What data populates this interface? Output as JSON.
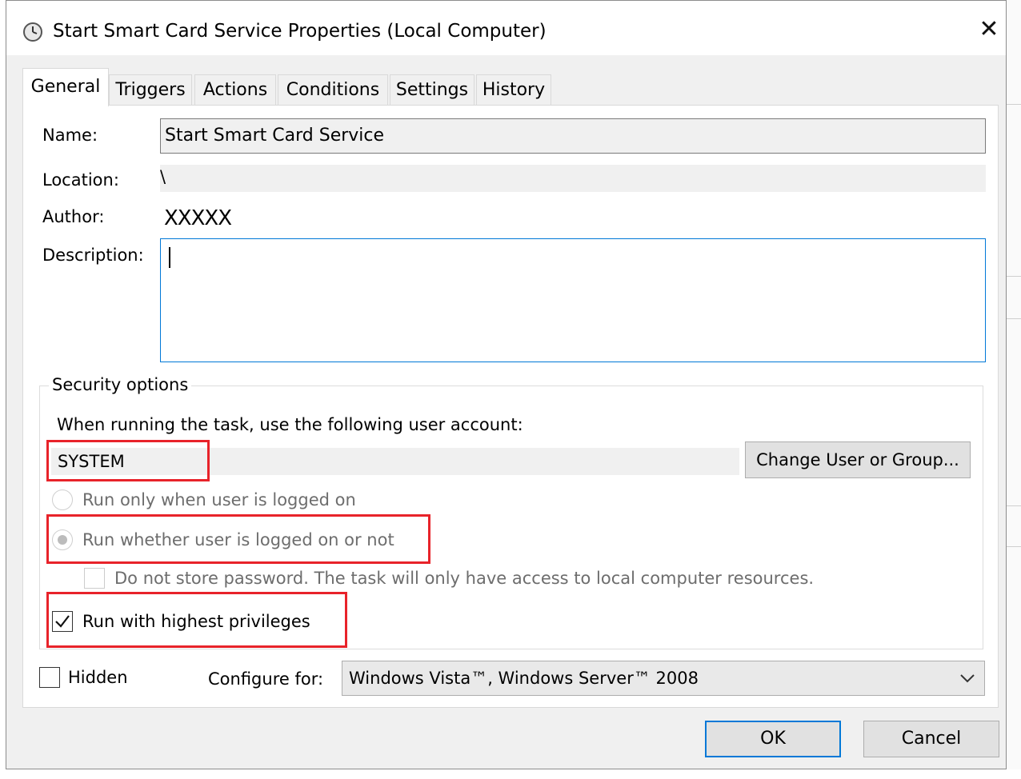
{
  "window": {
    "title": "Start Smart Card Service Properties (Local Computer)",
    "close_glyph": "✕",
    "icon": "clock-icon"
  },
  "tabs": [
    {
      "label": "General",
      "active": true
    },
    {
      "label": "Triggers"
    },
    {
      "label": "Actions"
    },
    {
      "label": "Conditions"
    },
    {
      "label": "Settings"
    },
    {
      "label": "History"
    }
  ],
  "general": {
    "name_label": "Name:",
    "name_value": "Start Smart Card Service",
    "location_label": "Location:",
    "location_value": "\\",
    "author_label": "Author:",
    "author_value": "XXXXX",
    "description_label": "Description:",
    "description_value": ""
  },
  "security": {
    "legend": "Security options",
    "account_prompt": "When running the task, use the following user account:",
    "account_value": "SYSTEM",
    "change_button": "Change User or Group...",
    "radio_logged_on": "Run only when user is logged on",
    "radio_whether": "Run whether user is logged on or not",
    "radio_selected": "whether",
    "no_store_password": "Do not store password.  The task will only have access to local computer resources.",
    "highest_privileges": "Run with highest privileges",
    "highest_privileges_checked": true
  },
  "bottom": {
    "hidden_label": "Hidden",
    "hidden_checked": false,
    "configure_label": "Configure for:",
    "configure_value": "Windows Vista™, Windows Server™ 2008"
  },
  "buttons": {
    "ok": "OK",
    "cancel": "Cancel"
  },
  "colors": {
    "highlight_box": "#e8232a",
    "focus_blue": "#0078d7",
    "dialog_bg": "#f0f0f0"
  }
}
